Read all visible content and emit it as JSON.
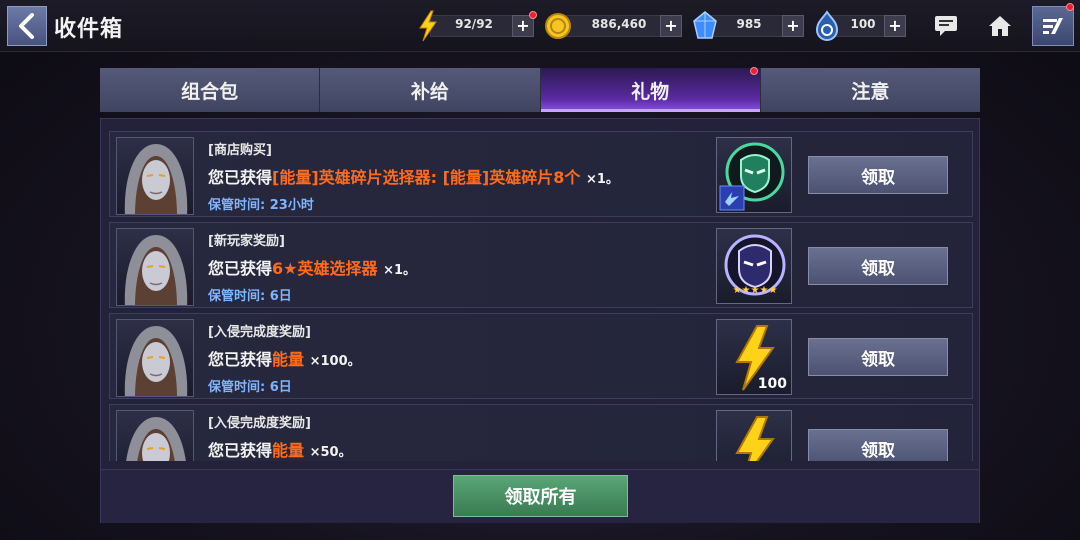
{
  "header": {
    "title": "收件箱",
    "resources": {
      "energy": "92/92",
      "gold": "886,460",
      "crystal": "985",
      "stamina": "100"
    }
  },
  "tabs": [
    {
      "label": "组合包"
    },
    {
      "label": "补给"
    },
    {
      "label": "礼物"
    },
    {
      "label": "注意"
    }
  ],
  "active_tab": "礼物",
  "items": [
    {
      "category": "[商店购买]",
      "prefix": "您已获得",
      "highlight": "[能量]英雄碎片选择器: [能量]英雄碎片8个",
      "qty": "×1。",
      "storage": "保管时间: 23小时",
      "reward_icon": "helmet-green-icon",
      "reward_count": ""
    },
    {
      "category": "[新玩家奖励]",
      "prefix": "您已获得",
      "highlight": "6★英雄选择器",
      "qty": "×1。",
      "storage": "保管时间: 6日",
      "reward_icon": "helmet-purple-icon",
      "reward_count": ""
    },
    {
      "category": "[入侵完成度奖励]",
      "prefix": "您已获得",
      "highlight": "能量",
      "qty": "×100。",
      "storage": "保管时间: 6日",
      "reward_icon": "lightning-icon",
      "reward_count": "100"
    },
    {
      "category": "[入侵完成度奖励]",
      "prefix": "您已获得",
      "highlight": "能量",
      "qty": "×50。",
      "storage": "",
      "reward_icon": "lightning-icon",
      "reward_count": ""
    }
  ],
  "claim_label": "领取",
  "claim_all_label": "领取所有",
  "colors": {
    "highlight": "#ff6b1a",
    "storage_text": "#7fb4ff",
    "claim_all": "#4a9166",
    "active_tab": "#6a34c0"
  }
}
